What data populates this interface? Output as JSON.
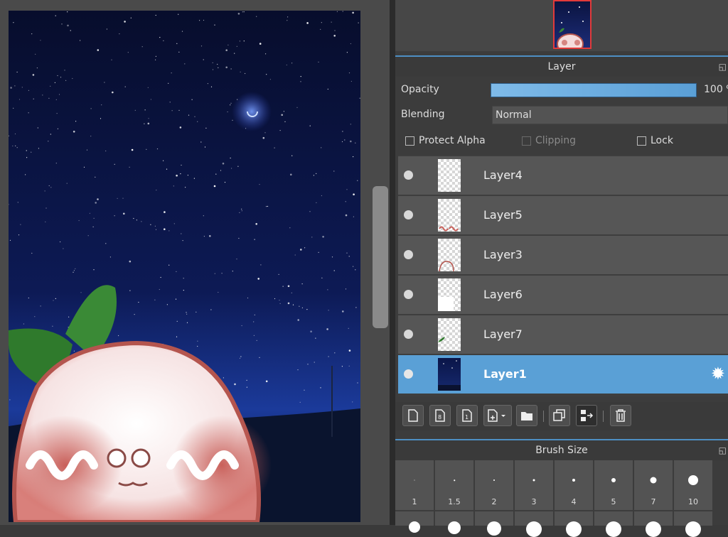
{
  "layer_panel": {
    "title": "Layer",
    "opacity_label": "Opacity",
    "opacity_value": "100 %",
    "opacity_fraction": 1.0,
    "blending_label": "Blending",
    "blending_value": "Normal",
    "protect_alpha_label": "Protect Alpha",
    "clipping_label": "Clipping",
    "lock_label": "Lock",
    "layers": [
      {
        "name": "Layer4",
        "selected": false
      },
      {
        "name": "Layer5",
        "selected": false
      },
      {
        "name": "Layer3",
        "selected": false
      },
      {
        "name": "Layer6",
        "selected": false
      },
      {
        "name": "Layer7",
        "selected": false
      },
      {
        "name": "Layer1",
        "selected": true
      }
    ]
  },
  "toolbar_icons": [
    "new-layer-icon",
    "new-8bit-layer-icon",
    "new-1bit-layer-icon",
    "add-layer-menu-icon",
    "folder-icon",
    "duplicate-layer-icon",
    "merge-down-icon",
    "delete-icon"
  ],
  "brush_panel": {
    "title": "Brush Size",
    "sizes": [
      "1",
      "1.5",
      "2",
      "3",
      "4",
      "5",
      "7",
      "10"
    ]
  },
  "colors": {
    "accent": "#5aa0d6",
    "panel_bg": "#3c3c3c",
    "row_bg": "#565656",
    "thumb_border": "#e23a3a"
  }
}
